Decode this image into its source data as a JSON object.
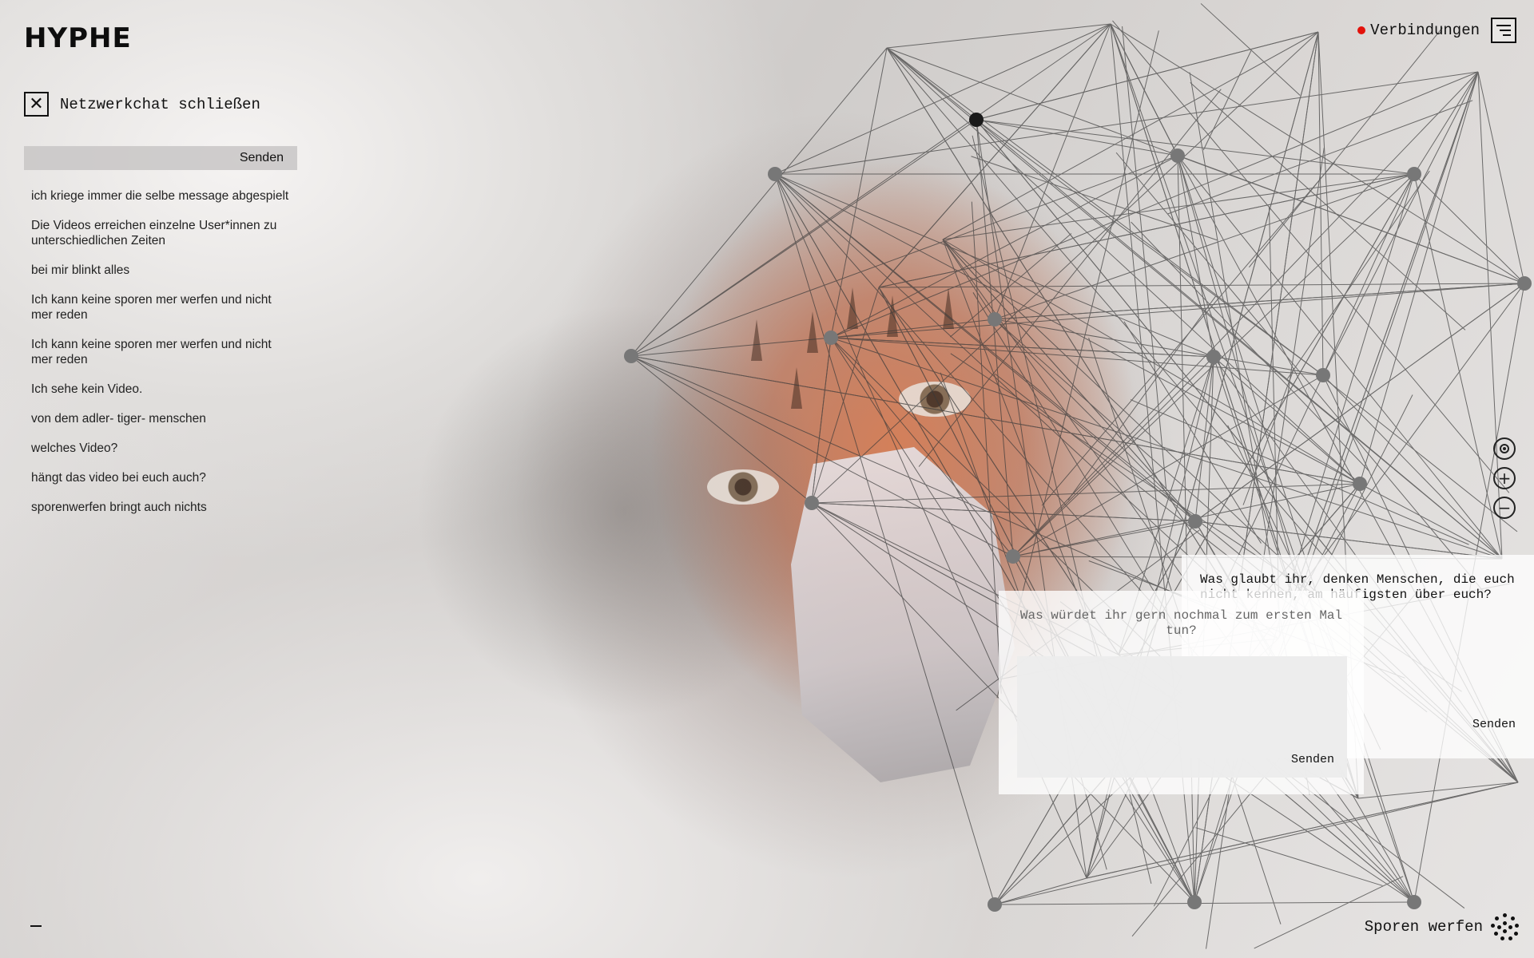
{
  "app": {
    "logo": "HYPHE"
  },
  "header": {
    "connections_label": "Verbindungen",
    "status_color": "#e3120b",
    "menu_icon": "hamburger-icon"
  },
  "chat": {
    "close_label": "Netzwerkchat schließen",
    "input_value": "",
    "send_label": "Senden",
    "messages": [
      "ich kriege immer die selbe message abgespielt",
      "Die Videos erreichen einzelne User*innen zu unterschiedlichen Zeiten",
      "bei mir blinkt alles",
      "Ich kann keine sporen mer werfen und nicht mer reden",
      "Ich kann keine sporen mer werfen und nicht mer reden",
      "Ich sehe kein Video.",
      "von dem adler- tiger- menschen",
      "welches Video?",
      "hängt das video bei euch auch?",
      "sporenwerfen bringt auch nichts"
    ]
  },
  "zoom": {
    "locate_icon": "target-icon",
    "zoom_in": "+",
    "zoom_out": "−"
  },
  "cards": {
    "back": {
      "question": "Was glaubt ihr, denken Menschen, die euch nicht kennen, am häufigsten über euch?",
      "send_label": "Senden"
    },
    "front": {
      "question": "Was würdet ihr gern nochmal zum ersten Mal tun?",
      "send_label": "Senden"
    }
  },
  "footer": {
    "spores_label": "Sporen werfen",
    "spores_icon": "spores-icon",
    "collapse_label": "–"
  }
}
